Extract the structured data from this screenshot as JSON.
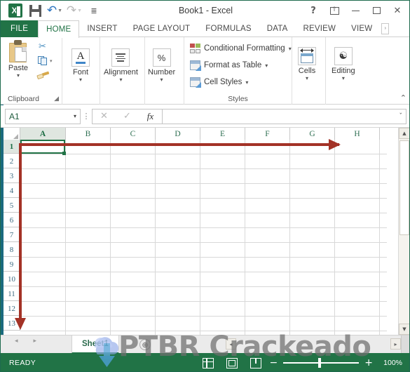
{
  "window": {
    "title": "Book1 - Excel",
    "qat": [
      {
        "name": "excel-logo",
        "label": "Excel"
      },
      {
        "name": "save-icon",
        "label": "Save"
      },
      {
        "name": "undo-icon",
        "label": "Undo"
      },
      {
        "name": "redo-icon",
        "label": "Redo"
      },
      {
        "name": "customize-qat-icon",
        "label": "Customize Quick Access Toolbar"
      }
    ],
    "controls": {
      "help": "?",
      "ribbon_display_options": "ribbon-display-options",
      "minimize": "minimize",
      "restore": "restore",
      "close": "✕"
    }
  },
  "ribbon": {
    "tabs": [
      {
        "label": "FILE",
        "active": false,
        "is_file": true
      },
      {
        "label": "HOME",
        "active": true
      },
      {
        "label": "INSERT",
        "active": false
      },
      {
        "label": "PAGE LAYOUT",
        "active": false
      },
      {
        "label": "FORMULAS",
        "active": false
      },
      {
        "label": "DATA",
        "active": false
      },
      {
        "label": "REVIEW",
        "active": false
      },
      {
        "label": "VIEW",
        "active": false
      }
    ],
    "tab_overflow": "›",
    "collapse_label": "⌃",
    "groups": [
      {
        "name": "clipboard",
        "label": "Clipboard",
        "has_launcher": true,
        "buttons": [
          {
            "label": "Paste",
            "dropdown": "▾"
          },
          {
            "label": "Cut",
            "icon": "scissors-icon"
          },
          {
            "label": "Copy",
            "icon": "copy-icon",
            "dropdown": "▾"
          },
          {
            "label": "Format Painter",
            "icon": "format-painter-icon"
          }
        ]
      },
      {
        "name": "font",
        "label": "",
        "buttons": [
          {
            "label": "Font",
            "dropdown": "▾"
          }
        ]
      },
      {
        "name": "alignment",
        "label": "",
        "buttons": [
          {
            "label": "Alignment",
            "dropdown": "▾"
          }
        ]
      },
      {
        "name": "number",
        "label": "",
        "buttons": [
          {
            "label": "Number",
            "dropdown": "▾"
          }
        ]
      },
      {
        "name": "styles",
        "label": "Styles",
        "items": [
          {
            "label": "Conditional Formatting",
            "caret": "▾"
          },
          {
            "label": "Format as Table",
            "caret": "▾"
          },
          {
            "label": "Cell Styles",
            "caret": "▾"
          }
        ]
      },
      {
        "name": "cells",
        "label": "",
        "buttons": [
          {
            "label": "Cells",
            "dropdown": "▾"
          }
        ]
      },
      {
        "name": "editing",
        "label": "",
        "buttons": [
          {
            "label": "Editing",
            "dropdown": "▾"
          }
        ]
      }
    ]
  },
  "formula_bar": {
    "name_box_value": "A1",
    "name_box_caret": "▾",
    "menu_dots": "⋮",
    "cancel": "✕",
    "enter": "✓",
    "insert_function": "fx",
    "input_value": "",
    "input_placeholder": "",
    "expand_caret": "ˇ"
  },
  "grid": {
    "columns": [
      "A",
      "B",
      "C",
      "D",
      "E",
      "F",
      "G",
      "H"
    ],
    "selected_column": "A",
    "rows": [
      "1",
      "2",
      "3",
      "4",
      "5",
      "6",
      "7",
      "8",
      "9",
      "10",
      "11",
      "12",
      "13"
    ],
    "selected_row": "1",
    "active_cell": "A1",
    "active_cell_value": ""
  },
  "annotations": [
    {
      "name": "red-arrow-right",
      "direction": "right",
      "color": "#a33226"
    },
    {
      "name": "red-arrow-down",
      "direction": "down",
      "color": "#a33226"
    }
  ],
  "sheet_tabs": {
    "prev": "◂",
    "next": "▸",
    "tabs": [
      {
        "label": "Sheet1",
        "active": true
      }
    ],
    "new_sheet": "⊕",
    "hscroll_left": "◂",
    "hscroll_right": "▸"
  },
  "status_bar": {
    "status": "READY",
    "views": [
      {
        "name": "normal-view-icon",
        "label": "Normal"
      },
      {
        "name": "page-layout-view-icon",
        "label": "Page Layout"
      },
      {
        "name": "page-break-preview-icon",
        "label": "Page Break Preview"
      }
    ],
    "zoom_out": "−",
    "zoom_in": "+",
    "zoom_level": "100%"
  },
  "watermark": {
    "text": "PTBR Crackeado",
    "logo": "cloud-download-icon"
  },
  "colors": {
    "excel_green": "#217346",
    "status_green": "#217346",
    "annotation_red": "#a33226",
    "tab_active_text": "#217346"
  }
}
